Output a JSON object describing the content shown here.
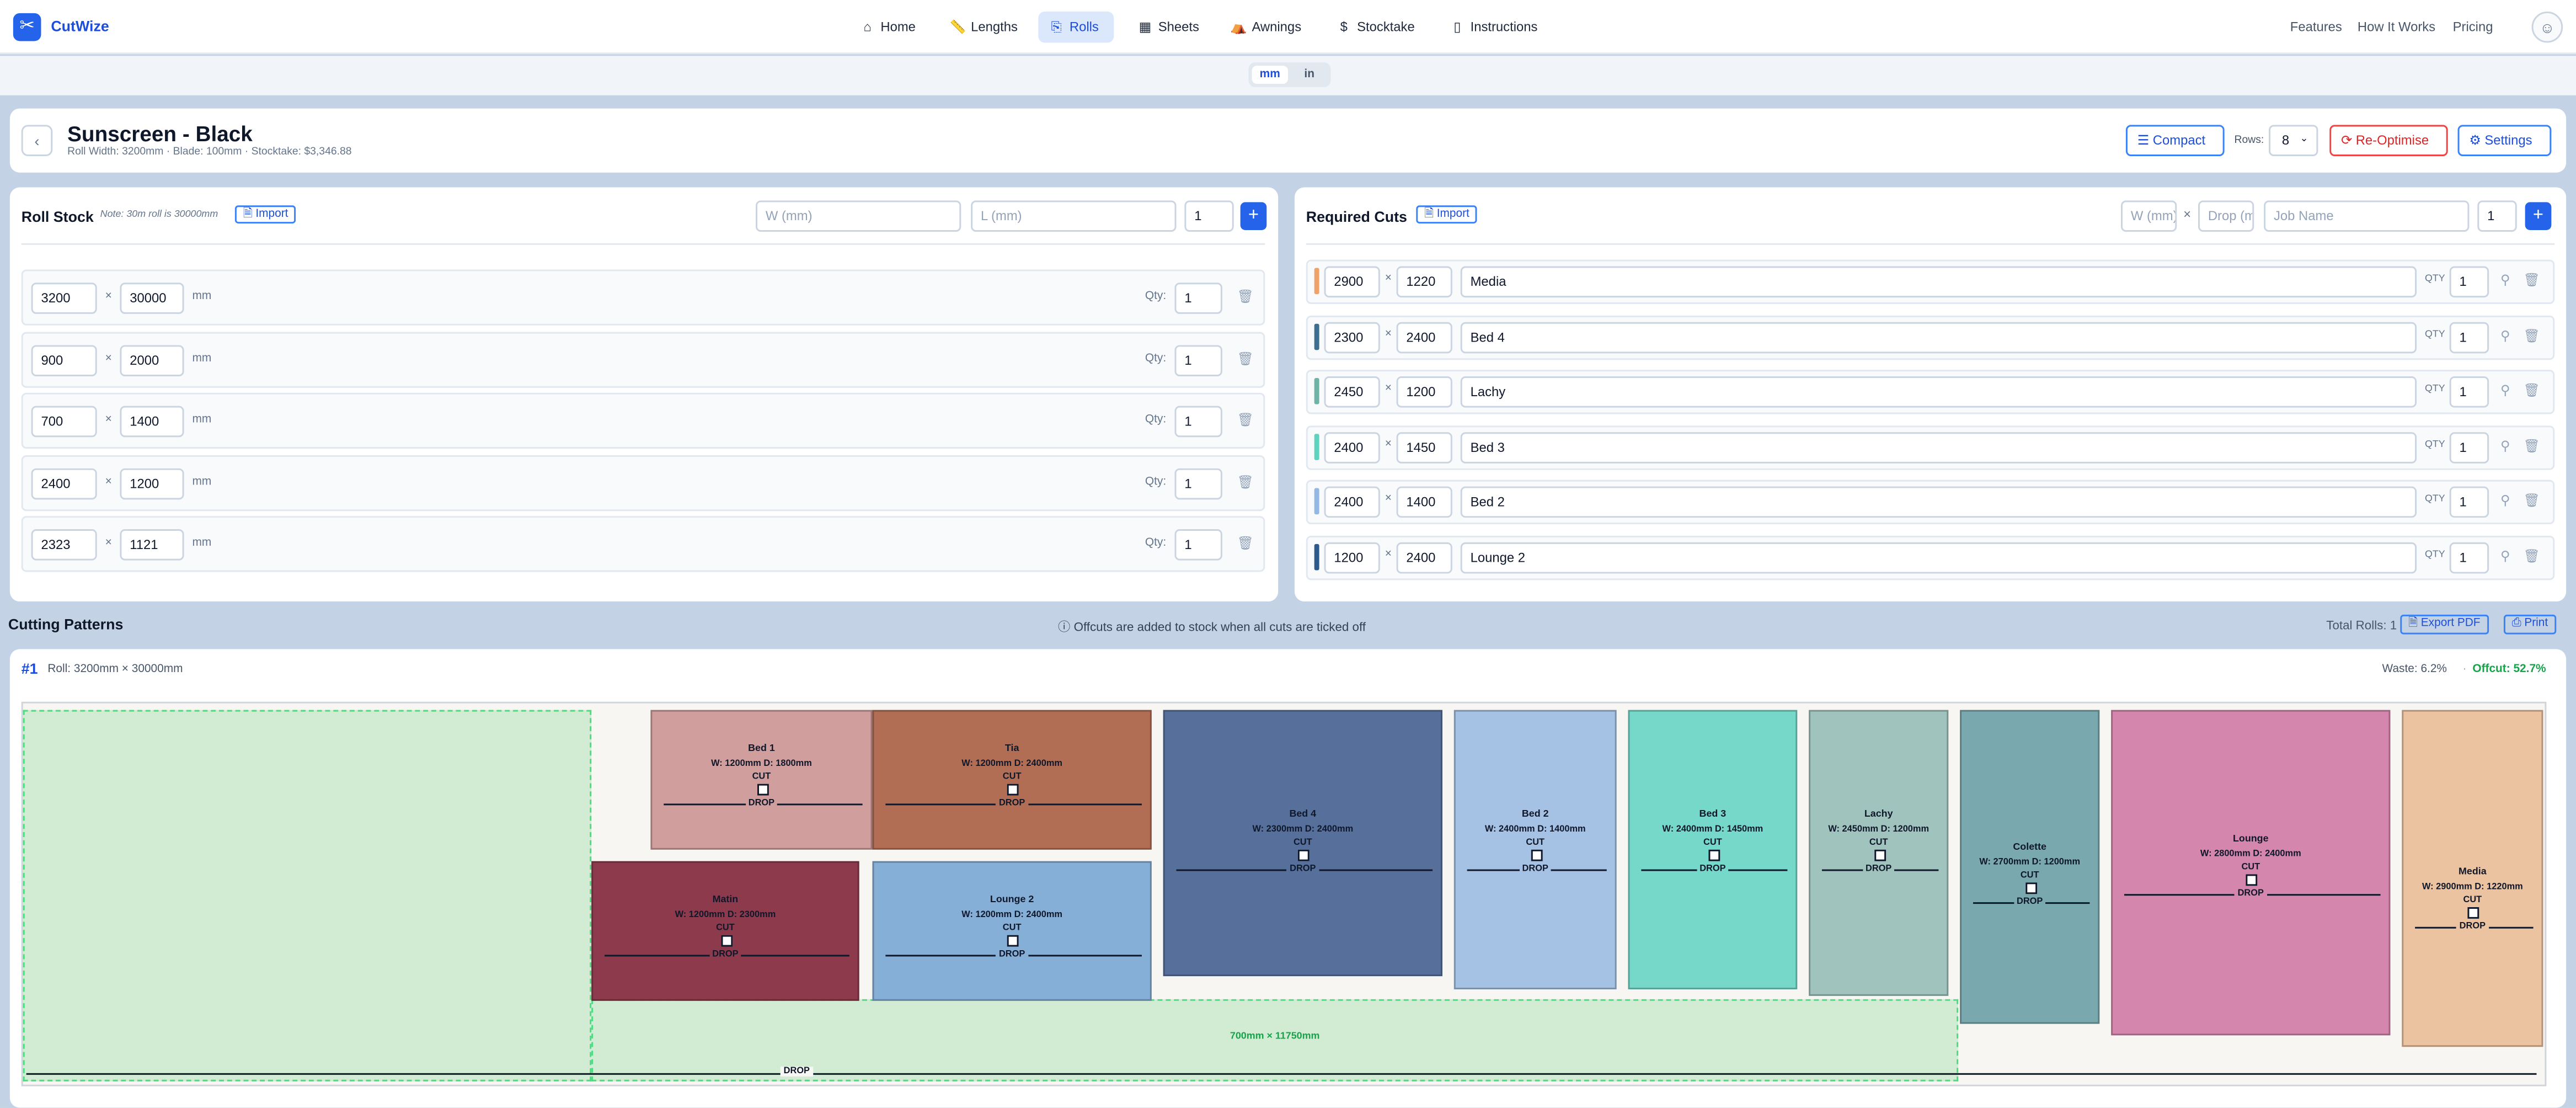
{
  "app": {
    "name": "CutWize"
  },
  "nav": {
    "items": [
      {
        "label": "Home",
        "icon": "home-icon"
      },
      {
        "label": "Lengths",
        "icon": "ruler-icon"
      },
      {
        "label": "Rolls",
        "icon": "roll-icon",
        "active": true
      },
      {
        "label": "Sheets",
        "icon": "grid-icon"
      },
      {
        "label": "Awnings",
        "icon": "awning-icon"
      },
      {
        "label": "Stocktake",
        "icon": "dollar-icon"
      },
      {
        "label": "Instructions",
        "icon": "book-icon"
      }
    ],
    "links": [
      "Features",
      "How It Works",
      "Pricing"
    ]
  },
  "units": {
    "mm": "mm",
    "in": "in",
    "selected": "mm"
  },
  "header": {
    "title": "Sunscreen - Black",
    "subtitle": "Roll Width: 3200mm · Blade: 100mm · Stocktake: $3,346.88",
    "compact": "Compact",
    "rows_label": "Rows:",
    "rows_value": "8",
    "reoptimise": "Re-Optimise",
    "settings": "Settings"
  },
  "roll_stock": {
    "title": "Roll Stock",
    "note": "Note: 30m roll is 30000mm",
    "import": "Import",
    "w_placeholder": "W (mm)",
    "l_placeholder": "L (mm)",
    "qty_default": "1",
    "unit": "mm",
    "qty_label": "Qty:",
    "rows": [
      {
        "w": "3200",
        "l": "30000",
        "qty": "1"
      },
      {
        "w": "900",
        "l": "2000",
        "qty": "1"
      },
      {
        "w": "700",
        "l": "1400",
        "qty": "1"
      },
      {
        "w": "2400",
        "l": "1200",
        "qty": "1"
      },
      {
        "w": "2323",
        "l": "1121",
        "qty": "1"
      }
    ]
  },
  "required_cuts": {
    "title": "Required Cuts",
    "import": "Import",
    "w_placeholder": "W (mm)",
    "drop_placeholder": "Drop (mm)",
    "name_placeholder": "Job Name",
    "qty_default": "1",
    "qty_label": "QTY",
    "rows": [
      {
        "w": "2900",
        "d": "1220",
        "name": "Media",
        "qty": "1",
        "color": "#f0a26b"
      },
      {
        "w": "2300",
        "d": "2400",
        "name": "Bed 4",
        "qty": "1",
        "color": "#3b6e8f"
      },
      {
        "w": "2450",
        "d": "1200",
        "name": "Lachy",
        "qty": "1",
        "color": "#6db4a6"
      },
      {
        "w": "2400",
        "d": "1450",
        "name": "Bed 3",
        "qty": "1",
        "color": "#5fd3c0"
      },
      {
        "w": "2400",
        "d": "1400",
        "name": "Bed 2",
        "qty": "1",
        "color": "#93b8e6"
      },
      {
        "w": "1200",
        "d": "2400",
        "name": "Lounge 2",
        "qty": "1",
        "color": "#2d5a8c"
      }
    ]
  },
  "patterns": {
    "title": "Cutting Patterns",
    "info": "Offcuts are added to stock when all cuts are ticked off",
    "total_rolls": "Total Rolls: 1",
    "export": "Export PDF",
    "print": "Print",
    "roll_number": "#1",
    "roll_desc": "Roll: 3200mm × 30000mm",
    "waste": "Waste: 6.2%",
    "offcut": "Offcut: 52.7%",
    "cut_label": "CUT",
    "drop_label": "DROP",
    "offcut_piece_label": "700mm × 11750mm",
    "pieces": [
      {
        "name": "Bed 1",
        "dims": "W: 1200mm D: 1800mm",
        "color": "#d09e9c"
      },
      {
        "name": "Tia",
        "dims": "W: 1200mm D: 2400mm",
        "color": "#b26e55"
      },
      {
        "name": "Matin",
        "dims": "W: 1200mm D: 2300mm",
        "color": "#8c3a4c"
      },
      {
        "name": "Lounge 2",
        "dims": "W: 1200mm D: 2400mm",
        "color": "#85afd6"
      },
      {
        "name": "Bed 4",
        "dims": "W: 2300mm D: 2400mm",
        "color": "#56709b"
      },
      {
        "name": "Bed 2",
        "dims": "W: 2400mm D: 1400mm",
        "color": "#a5c1e4"
      },
      {
        "name": "Bed 3",
        "dims": "W: 2400mm D: 1450mm",
        "color": "#75d8c8"
      },
      {
        "name": "Lachy",
        "dims": "W: 2450mm D: 1200mm",
        "color": "#a0c4bd"
      },
      {
        "name": "Colette",
        "dims": "W: 2700mm D: 1200mm",
        "color": "#79a9ae"
      },
      {
        "name": "Lounge",
        "dims": "W: 2800mm D: 2400mm",
        "color": "#d586ad"
      },
      {
        "name": "Media",
        "dims": "W: 2900mm D: 1220mm",
        "color": "#ecc3a0"
      }
    ]
  }
}
